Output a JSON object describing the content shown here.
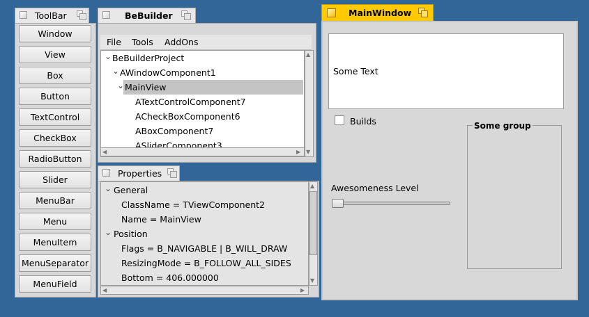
{
  "toolbar": {
    "title": "ToolBar",
    "buttons": [
      "Window",
      "View",
      "Box",
      "Button",
      "TextControl",
      "CheckBox",
      "RadioButton",
      "Slider",
      "MenuBar",
      "Menu",
      "MenuItem",
      "MenuSeparator",
      "MenuField"
    ]
  },
  "bebuilder": {
    "title": "BeBuilder",
    "menu": [
      "File",
      "Tools",
      "AddOns"
    ],
    "tree": [
      {
        "label": "BeBuilderProject",
        "expanded": true
      },
      {
        "label": "AWindowComponent1",
        "expanded": true
      },
      {
        "label": "MainView",
        "expanded": true,
        "selected": true
      },
      {
        "label": "ATextControlComponent7"
      },
      {
        "label": "ACheckBoxComponent6"
      },
      {
        "label": "ABoxComponent7"
      },
      {
        "label": "ASliderComponent3"
      }
    ]
  },
  "properties": {
    "title": "Properties",
    "rows": [
      {
        "label": "General",
        "expanded": true
      },
      {
        "label": "ClassName = TViewComponent2"
      },
      {
        "label": "Name = MainView"
      },
      {
        "label": "Position",
        "expanded": true
      },
      {
        "label": "Flags = B_NAVIGABLE | B_WILL_DRAW"
      },
      {
        "label": "ResizingMode = B_FOLLOW_ALL_SIDES"
      },
      {
        "label": "Bottom = 406.000000"
      }
    ]
  },
  "mainwindow": {
    "title": "MainWindow",
    "text_control_value": "Some Text",
    "checkbox_label": "Builds",
    "checkbox_checked": false,
    "slider_label": "Awesomeness Level",
    "slider_value": 0,
    "group_label": "Some group"
  },
  "icons": {
    "close": "close-box-icon",
    "zoom": "zoom-box-icon",
    "expand": "expand-arrow-icon",
    "scroll_left": "scroll-left-arrow-icon",
    "scroll_right": "scroll-right-arrow-icon",
    "scroll_up": "scroll-up-arrow-icon",
    "scroll_down": "scroll-down-arrow-icon"
  },
  "colors": {
    "desktop": "#336698",
    "active_tab": "#ffcb00",
    "panel": "#d8d8d8",
    "selection": "#c4c4c4"
  }
}
